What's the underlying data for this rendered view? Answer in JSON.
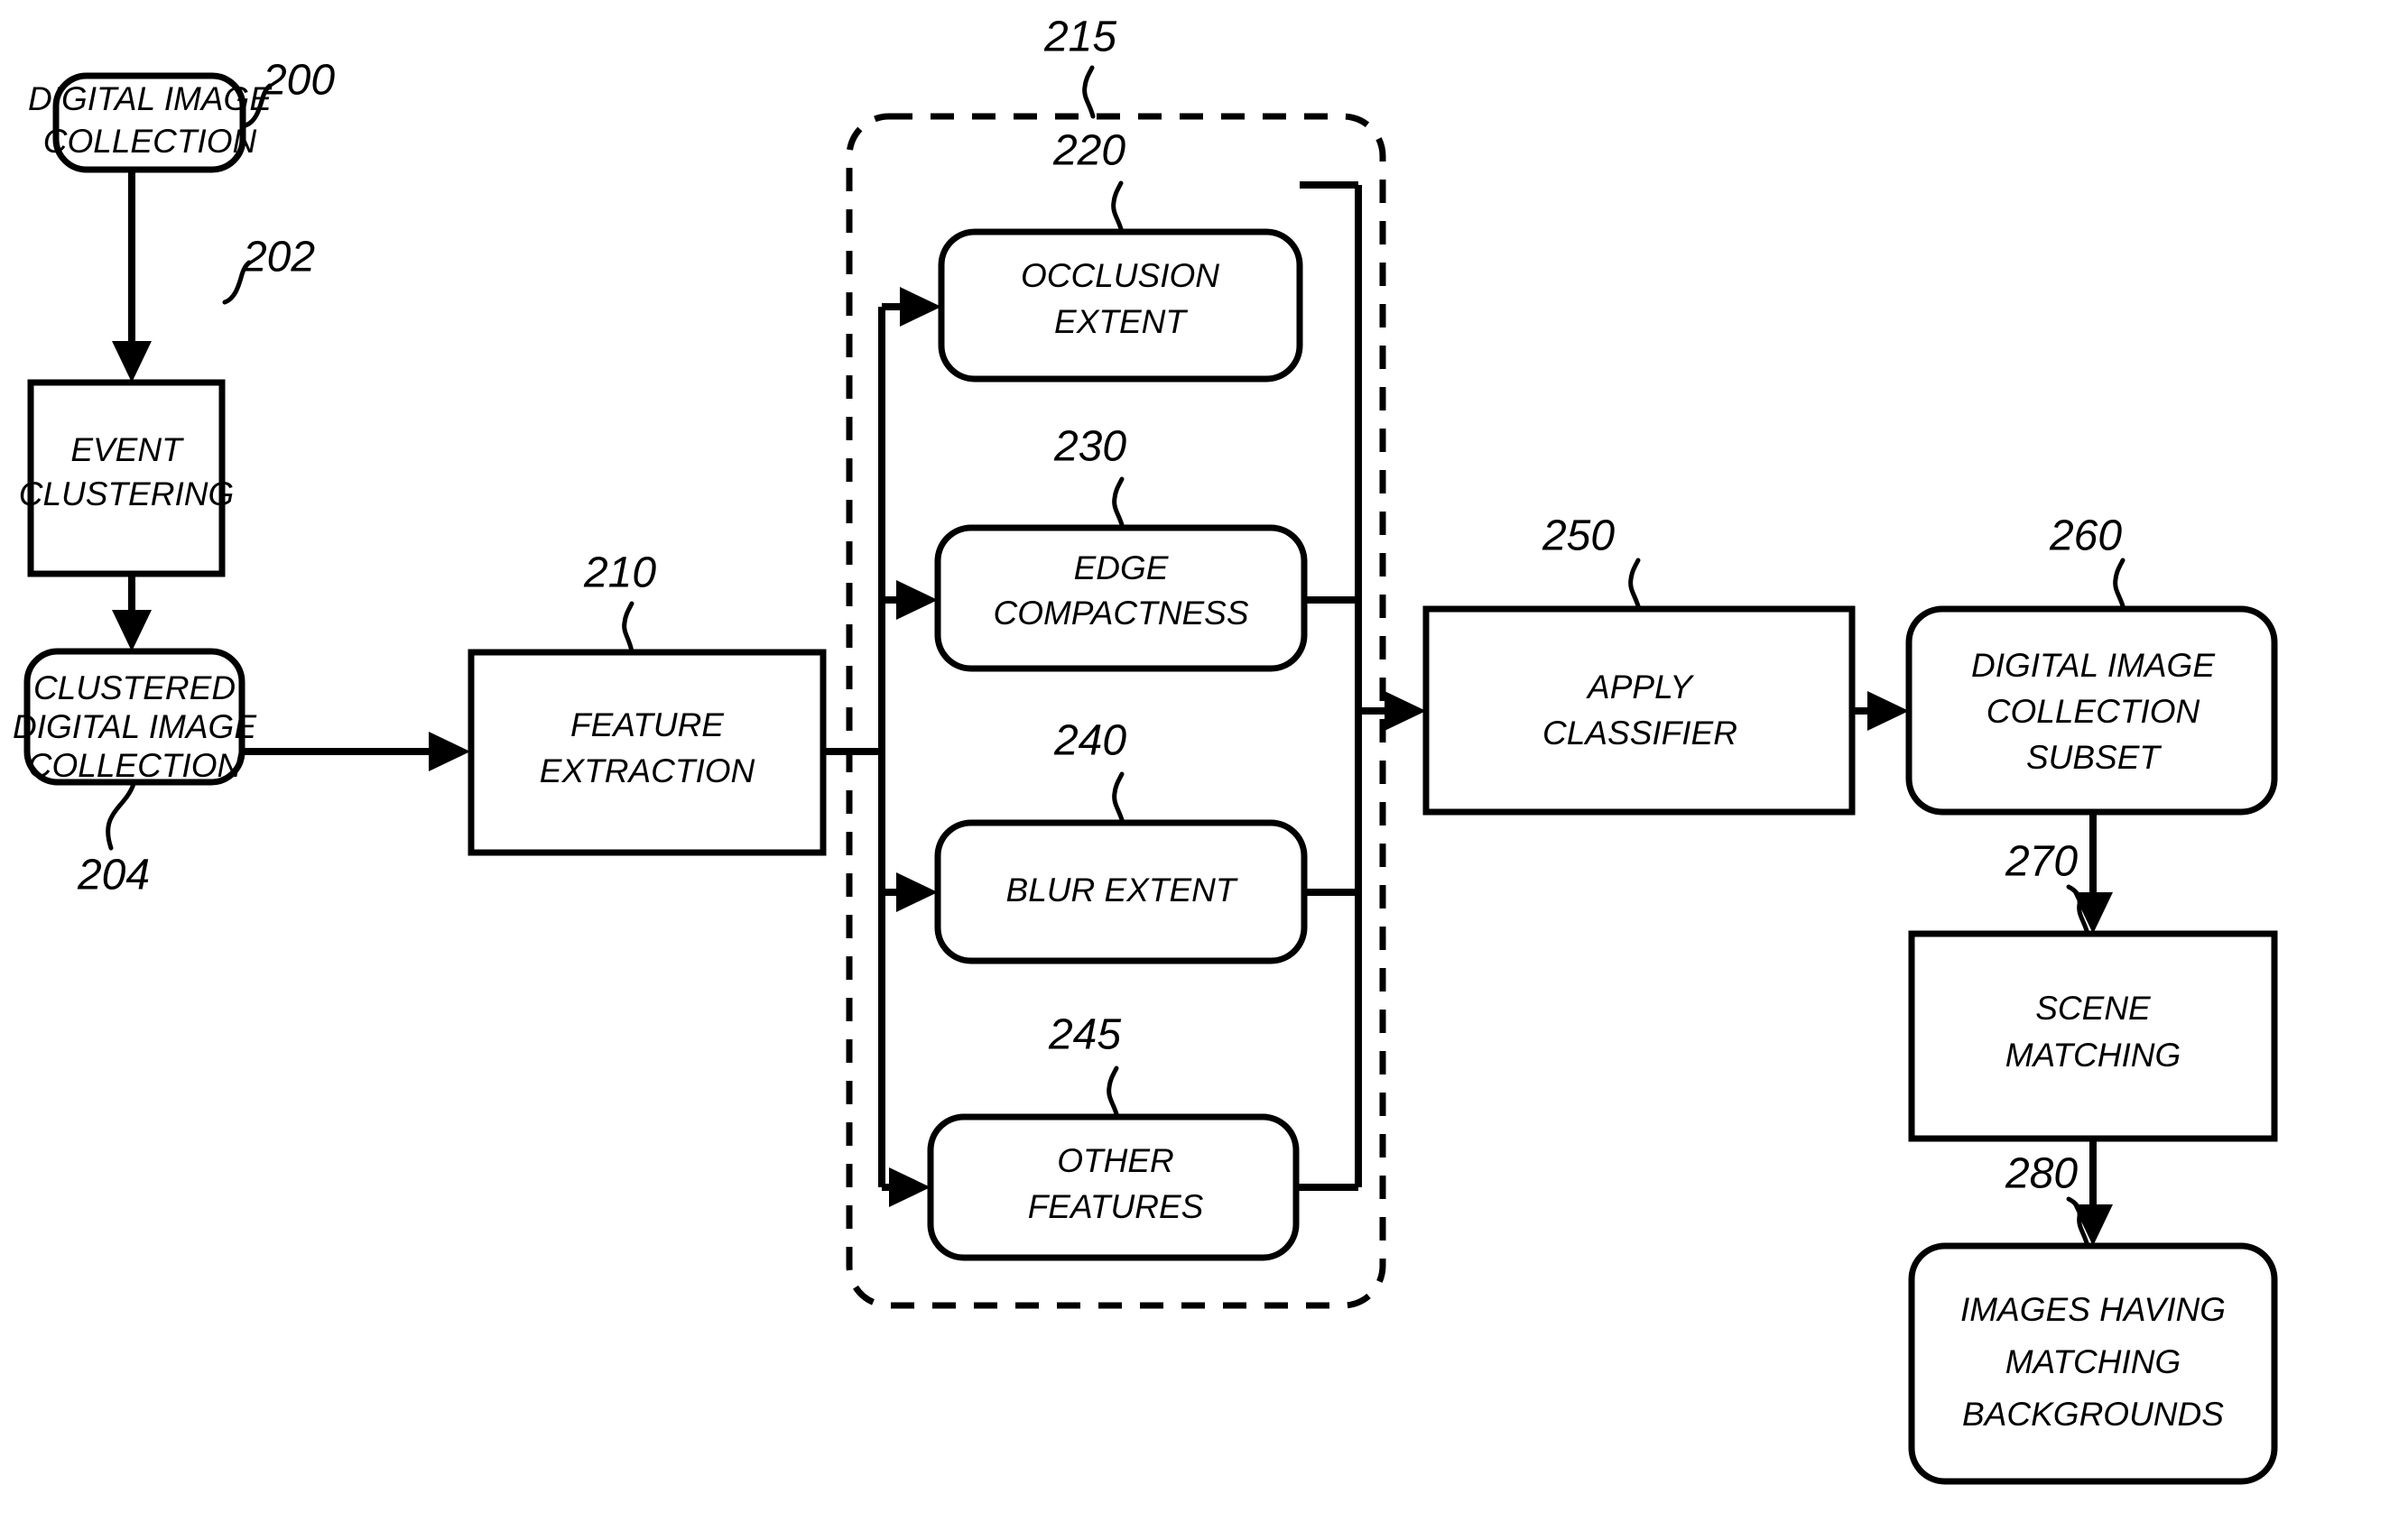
{
  "diagram": {
    "type": "patent-flowchart",
    "title": "Digital image collection background matching flowchart",
    "nodes": [
      {
        "id": "n200",
        "ref": "200",
        "label_lines": [
          "DIGITAL IMAGE",
          "COLLECTION"
        ],
        "shape": "rounded"
      },
      {
        "id": "n202",
        "ref": "202",
        "label_lines": [
          "EVENT",
          "CLUSTERING"
        ],
        "shape": "rect"
      },
      {
        "id": "n204",
        "ref": "204",
        "label_lines": [
          "CLUSTERED",
          "DIGITAL IMAGE",
          "COLLECTION"
        ],
        "shape": "rounded"
      },
      {
        "id": "n210",
        "ref": "210",
        "label_lines": [
          "FEATURE",
          "EXTRACTION"
        ],
        "shape": "rect"
      },
      {
        "id": "n215",
        "ref": "215",
        "label_lines": [],
        "shape": "dashed-group"
      },
      {
        "id": "n220",
        "ref": "220",
        "label_lines": [
          "OCCLUSION",
          "EXTENT"
        ],
        "shape": "rounded"
      },
      {
        "id": "n230",
        "ref": "230",
        "label_lines": [
          "EDGE",
          "COMPACTNESS"
        ],
        "shape": "rounded"
      },
      {
        "id": "n240",
        "ref": "240",
        "label_lines": [
          "BLUR EXTENT"
        ],
        "shape": "rounded"
      },
      {
        "id": "n245",
        "ref": "245",
        "label_lines": [
          "OTHER",
          "FEATURES"
        ],
        "shape": "rounded"
      },
      {
        "id": "n250",
        "ref": "250",
        "label_lines": [
          "APPLY",
          "CLASSIFIER"
        ],
        "shape": "rect"
      },
      {
        "id": "n260",
        "ref": "260",
        "label_lines": [
          "DIGITAL IMAGE",
          "COLLECTION",
          "SUBSET"
        ],
        "shape": "rounded"
      },
      {
        "id": "n270",
        "ref": "270",
        "label_lines": [
          "SCENE",
          "MATCHING"
        ],
        "shape": "rect"
      },
      {
        "id": "n280",
        "ref": "280",
        "label_lines": [
          "IMAGES HAVING",
          "MATCHING",
          "BACKGROUNDS"
        ],
        "shape": "rounded"
      }
    ],
    "labels": {
      "n200_l0": "DIGITAL IMAGE",
      "n200_l1": "COLLECTION",
      "n202_l0": "EVENT",
      "n202_l1": "CLUSTERING",
      "n204_l0": "CLUSTERED",
      "n204_l1": "DIGITAL IMAGE",
      "n204_l2": "COLLECTION",
      "n210_l0": "FEATURE",
      "n210_l1": "EXTRACTION",
      "n220_l0": "OCCLUSION",
      "n220_l1": "EXTENT",
      "n230_l0": "EDGE",
      "n230_l1": "COMPACTNESS",
      "n240_l0": "BLUR EXTENT",
      "n245_l0": "OTHER",
      "n245_l1": "FEATURES",
      "n250_l0": "APPLY",
      "n250_l1": "CLASSIFIER",
      "n260_l0": "DIGITAL IMAGE",
      "n260_l1": "COLLECTION",
      "n260_l2": "SUBSET",
      "n270_l0": "SCENE",
      "n270_l1": "MATCHING",
      "n280_l0": "IMAGES HAVING",
      "n280_l1": "MATCHING",
      "n280_l2": "BACKGROUNDS"
    },
    "refs": {
      "r200": "200",
      "r202": "202",
      "r204": "204",
      "r210": "210",
      "r215": "215",
      "r220": "220",
      "r230": "230",
      "r240": "240",
      "r245": "245",
      "r250": "250",
      "r260": "260",
      "r270": "270",
      "r280": "280"
    },
    "colors": {
      "stroke": "#000000",
      "fill": "#ffffff",
      "background": "#ffffff"
    },
    "edges": [
      {
        "from": "n200",
        "to": "n202",
        "dir": "down"
      },
      {
        "from": "n202",
        "to": "n204",
        "dir": "down"
      },
      {
        "from": "n204",
        "to": "n210",
        "dir": "right"
      },
      {
        "from": "n210",
        "to": "n215",
        "dir": "right"
      },
      {
        "from": "bus-in",
        "to": "n220",
        "dir": "right"
      },
      {
        "from": "bus-in",
        "to": "n230",
        "dir": "right"
      },
      {
        "from": "bus-in",
        "to": "n240",
        "dir": "right"
      },
      {
        "from": "bus-in",
        "to": "n245",
        "dir": "right"
      },
      {
        "from": "n220",
        "to": "bus-out",
        "dir": "right"
      },
      {
        "from": "n230",
        "to": "bus-out",
        "dir": "right"
      },
      {
        "from": "n240",
        "to": "bus-out",
        "dir": "right"
      },
      {
        "from": "n245",
        "to": "bus-out",
        "dir": "right"
      },
      {
        "from": "bus-out",
        "to": "n250",
        "dir": "right"
      },
      {
        "from": "n250",
        "to": "n260",
        "dir": "right"
      },
      {
        "from": "n260",
        "to": "n270",
        "dir": "down"
      },
      {
        "from": "n270",
        "to": "n280",
        "dir": "down"
      }
    ]
  }
}
